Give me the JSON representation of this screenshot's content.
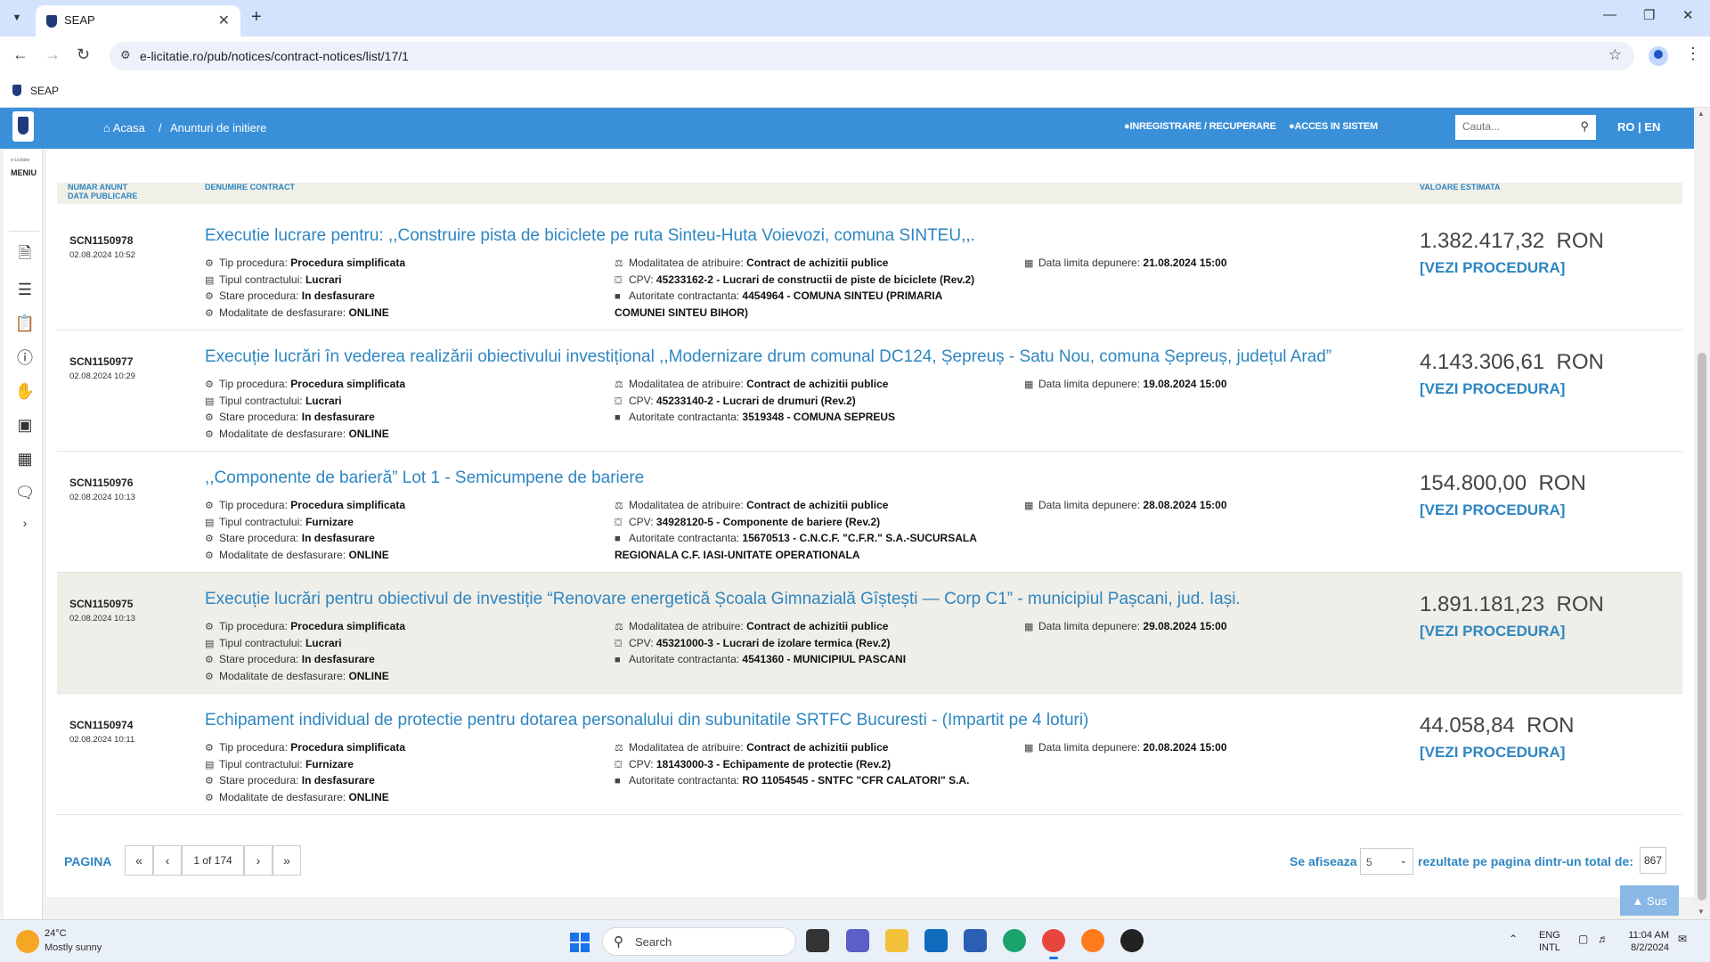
{
  "browser": {
    "tab_title": "SEAP",
    "url": "e-licitatie.ro/pub/notices/contract-notices/list/17/1",
    "bookmark": "SEAP"
  },
  "site": {
    "breadcrumb_home": "Acasa",
    "breadcrumb_sep": "/",
    "breadcrumb_current": "Anunturi de initiere",
    "register_link": "INREGISTRARE / RECUPERARE",
    "login_link": "ACCES IN SISTEM",
    "search_placeholder": "Cauta...",
    "language": "RO | EN",
    "brand_color": "#3a8fd9",
    "link_color": "#2e86c1"
  },
  "sidemenu": {
    "small_label": "e-Licitatie",
    "menu_label": "MENIU",
    "icons": [
      "document-icon",
      "list-edit-icon",
      "clipboard-icon",
      "help-icon",
      "hand-money-icon",
      "id-card-icon",
      "table-icon",
      "chat-icon"
    ],
    "expand": "›"
  },
  "columns": {
    "number": "NUMAR ANUNT",
    "date": "DATA PUBLICARE",
    "name": "DENUMIRE CONTRACT",
    "value": "VALOARE ESTIMATA"
  },
  "labels": {
    "procedure_type": "Tip procedura:",
    "contract_type": "Tipul contractului:",
    "status": "Stare procedura:",
    "mode": "Modalitate de desfasurare:",
    "award": "Modalitatea de atribuire:",
    "cpv": "CPV:",
    "authority": "Autoritate contractanta:",
    "deadline": "Data limita depunere:",
    "view": "[VEZI PROCEDURA]",
    "currency": "RON"
  },
  "notices": [
    {
      "id": "SCN1150978",
      "date": "02.08.2024 10:52",
      "title": "Executie lucrare pentru: ,,Construire pista de biciclete pe ruta Sinteu-Huta Voievozi, comuna SINTEU,,.",
      "procedure_type": "Procedura simplificata",
      "contract_type": "Lucrari",
      "status": "In desfasurare",
      "mode": "ONLINE",
      "award": "Contract de achizitii publice",
      "cpv": "45233162-2 - Lucrari de constructii de piste de biciclete (Rev.2)",
      "authority": "4454964 - COMUNA SINTEU (PRIMARIA",
      "authority_cont": "COMUNEI SINTEU BIHOR)",
      "deadline": "21.08.2024 15:00",
      "value": "1.382.417,32"
    },
    {
      "id": "SCN1150977",
      "date": "02.08.2024 10:29",
      "title": "Execuție lucrări în vederea realizării obiectivului investițional ,,Modernizare drum comunal DC124, Șepreuș - Satu Nou, comuna Șepreuș, județul Arad”",
      "procedure_type": "Procedura simplificata",
      "contract_type": "Lucrari",
      "status": "In desfasurare",
      "mode": "ONLINE",
      "award": "Contract de achizitii publice",
      "cpv": "45233140-2 - Lucrari de drumuri (Rev.2)",
      "authority": "3519348 - COMUNA SEPREUS",
      "authority_cont": "",
      "deadline": "19.08.2024 15:00",
      "value": "4.143.306,61"
    },
    {
      "id": "SCN1150976",
      "date": "02.08.2024 10:13",
      "title": ",,Componente de barieră” Lot 1 - Semicumpene de bariere",
      "procedure_type": "Procedura simplificata",
      "contract_type": "Furnizare",
      "status": "In desfasurare",
      "mode": "ONLINE",
      "award": "Contract de achizitii publice",
      "cpv": "34928120-5 - Componente de bariere (Rev.2)",
      "authority": "15670513 - C.N.C.F. \"C.F.R.\" S.A.-SUCURSALA",
      "authority_cont": "REGIONALA C.F. IASI-UNITATE OPERATIONALA",
      "deadline": "28.08.2024 15:00",
      "value": "154.800,00"
    },
    {
      "id": "SCN1150975",
      "date": "02.08.2024 10:13",
      "title": "Execuție lucrări pentru obiectivul de investiție “Renovare energetică Școala Gimnazială Gîștești — Corp C1” - municipiul Pașcani, jud. Iași.",
      "procedure_type": "Procedura simplificata",
      "contract_type": "Lucrari",
      "status": "In desfasurare",
      "mode": "ONLINE",
      "award": "Contract de achizitii publice",
      "cpv": "45321000-3 - Lucrari de izolare termica (Rev.2)",
      "authority": "4541360 - MUNICIPIUL PASCANI",
      "authority_cont": "",
      "deadline": "29.08.2024 15:00",
      "value": "1.891.181,23"
    },
    {
      "id": "SCN1150974",
      "date": "02.08.2024 10:11",
      "title": "Echipament individual de protectie pentru dotarea personalului din subunitatile SRTFC Bucuresti - (Impartit pe 4 loturi)",
      "procedure_type": "Procedura simplificata",
      "contract_type": "Furnizare",
      "status": "In desfasurare",
      "mode": "ONLINE",
      "award": "Contract de achizitii publice",
      "cpv": "18143000-3 - Echipamente de protectie (Rev.2)",
      "authority": "RO 11054545 - SNTFC \"CFR CALATORI\" S.A.",
      "authority_cont": "",
      "deadline": "20.08.2024 15:00",
      "value": "44.058,84"
    }
  ],
  "pagination": {
    "label": "PAGINA",
    "first": "«",
    "prev": "‹",
    "page": "1 of 174",
    "next": "›",
    "last": "»",
    "show_label": "Se afiseaza",
    "per_page": "5",
    "results_label": "rezultate pe pagina dintr-un total de:",
    "total": "867",
    "back_to_top": "Sus"
  },
  "taskbar": {
    "temperature": "24°C",
    "weather": "Mostly sunny",
    "search": "Search",
    "lang_top": "ENG",
    "lang_bottom": "INTL",
    "time": "11:04 AM",
    "date": "8/2/2024"
  }
}
